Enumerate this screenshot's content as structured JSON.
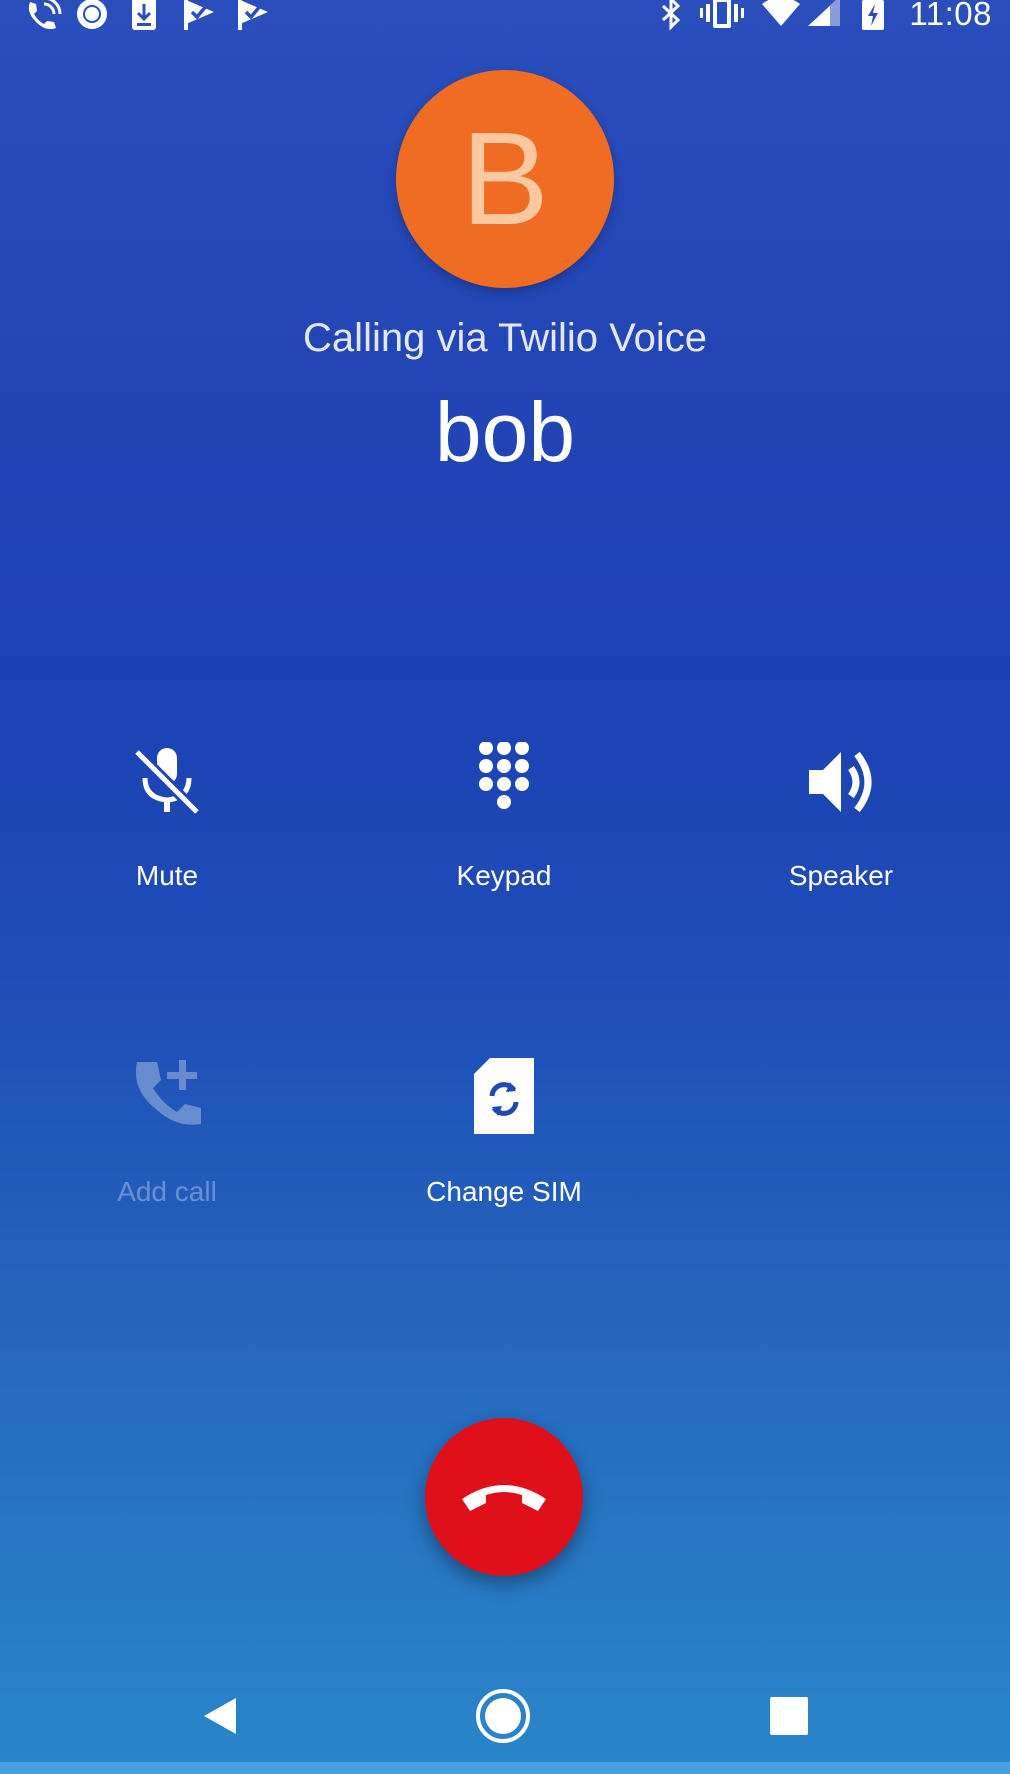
{
  "status_bar": {
    "time": "11:08",
    "left_icons": [
      "wifi-calling-icon",
      "circle-record-icon",
      "download-icon",
      "check-flag-icon",
      "check-flag-icon"
    ],
    "right_icons": [
      "bluetooth-icon",
      "vibrate-icon",
      "wifi-icon",
      "cell-signal-icon",
      "battery-charging-icon"
    ]
  },
  "caller": {
    "avatar_initial": "B",
    "avatar_color": "#ef6c22",
    "calling_via": "Calling via Twilio Voice",
    "name": "bob"
  },
  "controls": {
    "mute": {
      "label": "Mute",
      "icon": "mic-off-icon",
      "enabled": true
    },
    "keypad": {
      "label": "Keypad",
      "icon": "dialpad-icon",
      "enabled": true
    },
    "speaker": {
      "label": "Speaker",
      "icon": "speaker-icon",
      "enabled": true
    },
    "add_call": {
      "label": "Add call",
      "icon": "add-call-icon",
      "enabled": false
    },
    "change_sim": {
      "label": "Change SIM",
      "icon": "sim-swap-icon",
      "enabled": true
    }
  },
  "end_call": {
    "icon": "call-end-icon",
    "color": "#e0101a"
  },
  "nav_bar": {
    "back": "back-icon",
    "home": "home-icon",
    "recents": "recents-icon"
  },
  "colors": {
    "background_top": "#2a4ebc",
    "background_bottom": "#2a86ca"
  }
}
